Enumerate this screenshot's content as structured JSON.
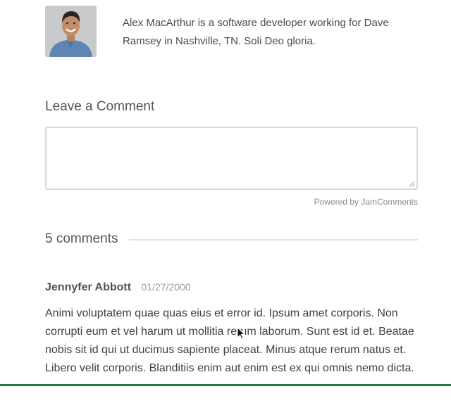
{
  "author": {
    "bio": "Alex MacArthur is a software developer working for Dave Ramsey in Nashville, TN. Soli Deo gloria.",
    "avatar_icon": "person-photo-icon"
  },
  "comment_form": {
    "heading": "Leave a Comment",
    "textarea_value": "",
    "powered_by": "Powered by JamComments"
  },
  "comments": {
    "count_label": "5 comments",
    "items": [
      {
        "author": "Jennyfer Abbott",
        "date": "01/27/2000",
        "body": "Animi voluptatem quae quas eius et error id. Ipsum amet corporis. Non corrupti eum et vel harum ut mollitia rerum laborum. Sunt est id et. Beatae nobis sit id qui ut ducimus sapiente placeat. Minus atque rerum natus et. Libero velit corporis. Blanditiis enim aut enim est ex qui omnis nemo dicta."
      }
    ]
  },
  "colors": {
    "accent_bar": "#1f7a3b"
  }
}
